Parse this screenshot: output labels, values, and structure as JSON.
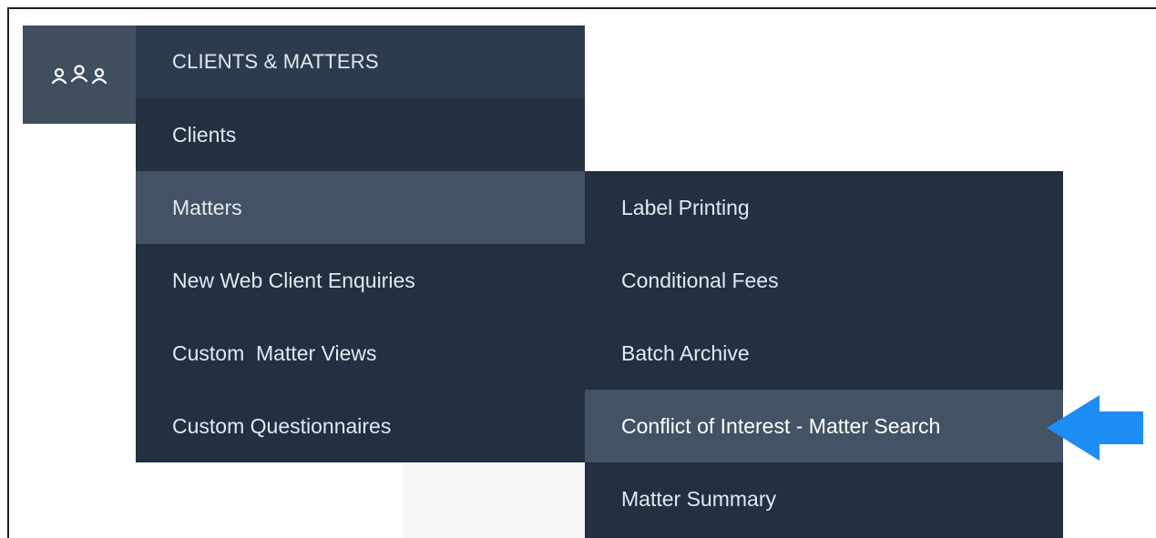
{
  "clients_icon": "users-group-icon",
  "menu": {
    "header": "CLIENTS & MATTERS",
    "items": [
      {
        "label": "Clients"
      },
      {
        "label": "Matters"
      },
      {
        "label": "New Web Client Enquiries"
      },
      {
        "label": "Custom  Matter Views"
      },
      {
        "label": "Custom Questionnaires"
      }
    ],
    "active_item": "Matters"
  },
  "submenu": {
    "items": [
      {
        "label": "Label Printing"
      },
      {
        "label": "Conditional Fees"
      },
      {
        "label": "Batch Archive"
      },
      {
        "label": "Conflict of Interest - Matter Search"
      },
      {
        "label": "Matter Summary"
      }
    ],
    "highlighted_item": "Conflict of Interest - Matter Search"
  },
  "pointer": {
    "icon": "arrow-left-icon",
    "color": "#1e8cf5"
  },
  "colors": {
    "menu_bg": "#22303f",
    "header_bg": "#2c3c4e",
    "active_bg": "#435264",
    "icon_tile_bg": "#404e5e",
    "text": "#e3e8ee"
  }
}
